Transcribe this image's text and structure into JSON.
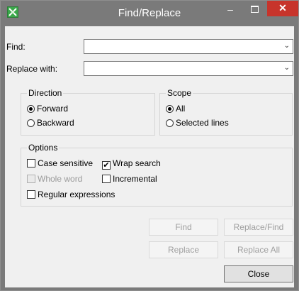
{
  "window": {
    "title": "Find/Replace",
    "min_glyph": "–",
    "close_glyph": "✕",
    "colors": {
      "titlebar": "#7a7a7a",
      "close": "#c7342b",
      "client": "#f0f0f0"
    }
  },
  "fields": {
    "find_label": "Find:",
    "find_value": "",
    "replace_label": "Replace with:",
    "replace_value": "",
    "dropdown_glyph": "⌄"
  },
  "direction": {
    "title": "Direction",
    "options": [
      {
        "label": "Forward",
        "selected": true
      },
      {
        "label": "Backward",
        "selected": false
      }
    ]
  },
  "scope": {
    "title": "Scope",
    "options": [
      {
        "label": "All",
        "selected": true
      },
      {
        "label": "Selected lines",
        "selected": false
      }
    ]
  },
  "options": {
    "title": "Options",
    "case_sensitive": {
      "label": "Case sensitive",
      "checked": false,
      "enabled": true
    },
    "wrap_search": {
      "label": "Wrap search",
      "checked": true,
      "enabled": true
    },
    "whole_word": {
      "label": "Whole word",
      "checked": false,
      "enabled": false
    },
    "incremental": {
      "label": "Incremental",
      "checked": false,
      "enabled": true
    },
    "regex": {
      "label": "Regular expressions",
      "checked": false,
      "enabled": true
    },
    "check_glyph": "✔"
  },
  "buttons": {
    "find": "Find",
    "replace_find": "Replace/Find",
    "replace": "Replace",
    "replace_all": "Replace All",
    "close": "Close"
  }
}
